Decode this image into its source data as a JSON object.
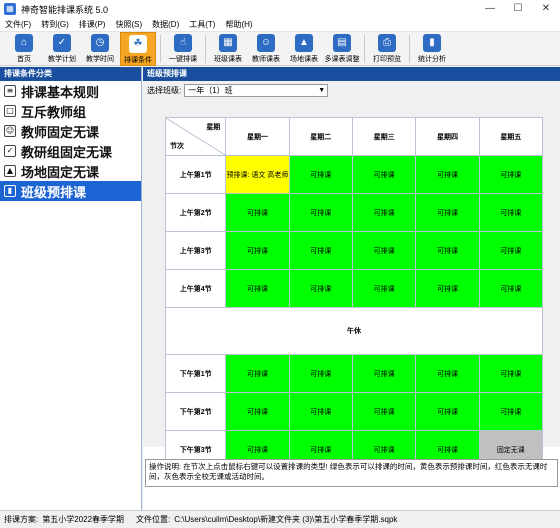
{
  "window": {
    "title": "神奇智能排课系统 5.0",
    "app_icon": "calendar-icon",
    "buttons": [
      "—",
      "☐",
      "✕"
    ]
  },
  "menu": [
    "文件(F)",
    "转到(G)",
    "排课(P)",
    "快照(S)",
    "数据(D)",
    "工具(T)",
    "帮助(H)"
  ],
  "toolbar": {
    "groups": [
      [
        {
          "label": "首页",
          "icon": "home-icon",
          "glyph": "⌂"
        },
        {
          "label": "教学计划",
          "icon": "checklist-icon",
          "glyph": "✓"
        },
        {
          "label": "教学时间",
          "icon": "clock-icon",
          "glyph": "◷"
        },
        {
          "label": "排课条件",
          "icon": "conditions-icon",
          "glyph": "☘",
          "active": true
        }
      ],
      [
        {
          "label": "一键排课",
          "icon": "tap-icon",
          "glyph": "☝"
        }
      ],
      [
        {
          "label": "班级课表",
          "icon": "class-table-icon",
          "glyph": "▦"
        },
        {
          "label": "教师课表",
          "icon": "teacher-table-icon",
          "glyph": "☺"
        },
        {
          "label": "场地课表",
          "icon": "venue-table-icon",
          "glyph": "▲"
        },
        {
          "label": "多课表调整",
          "icon": "multi-table-icon",
          "glyph": "▤"
        }
      ],
      [
        {
          "label": "打印预览",
          "icon": "print-icon",
          "glyph": "⎙"
        }
      ],
      [
        {
          "label": "统计分析",
          "icon": "chart-icon",
          "glyph": "▮"
        }
      ]
    ]
  },
  "left_panel": {
    "header": "排课条件分类",
    "items": [
      {
        "label": "排课基本规则",
        "icon": "rules-icon",
        "glyph": "≡"
      },
      {
        "label": "互斥教师组",
        "icon": "group-icon",
        "glyph": "□"
      },
      {
        "label": "教师固定无课",
        "icon": "teacher-icon",
        "glyph": "☺"
      },
      {
        "label": "教研组固定无课",
        "icon": "research-group-icon",
        "glyph": "✓"
      },
      {
        "label": "场地固定无课",
        "icon": "venue-icon",
        "glyph": "▲"
      },
      {
        "label": "班级预排课",
        "icon": "book-icon",
        "glyph": "▮",
        "selected": true
      }
    ]
  },
  "right_panel": {
    "header": "班级预排课",
    "select_label": "选择班级:",
    "select_value": "一年（1）班",
    "corner_day": "星期",
    "corner_period": "节次",
    "days": [
      "星期一",
      "星期二",
      "星期三",
      "星期四",
      "星期五"
    ],
    "noon_label": "午休",
    "rows": [
      {
        "period": "上午第1节",
        "cells": [
          {
            "text": "预排课: 语文 高老师",
            "state": "pre"
          },
          {
            "text": "可排课",
            "state": "ok"
          },
          {
            "text": "可排课",
            "state": "ok"
          },
          {
            "text": "可排课",
            "state": "ok"
          },
          {
            "text": "可排课",
            "state": "ok"
          }
        ]
      },
      {
        "period": "上午第2节",
        "cells": [
          {
            "text": "可排课",
            "state": "ok"
          },
          {
            "text": "可排课",
            "state": "ok"
          },
          {
            "text": "可排课",
            "state": "ok"
          },
          {
            "text": "可排课",
            "state": "ok"
          },
          {
            "text": "可排课",
            "state": "ok"
          }
        ]
      },
      {
        "period": "上午第3节",
        "cells": [
          {
            "text": "可排课",
            "state": "ok"
          },
          {
            "text": "可排课",
            "state": "ok"
          },
          {
            "text": "可排课",
            "state": "ok"
          },
          {
            "text": "可排课",
            "state": "ok"
          },
          {
            "text": "可排课",
            "state": "ok"
          }
        ]
      },
      {
        "period": "上午第4节",
        "cells": [
          {
            "text": "可排课",
            "state": "ok"
          },
          {
            "text": "可排课",
            "state": "ok"
          },
          {
            "text": "可排课",
            "state": "ok"
          },
          {
            "text": "可排课",
            "state": "ok"
          },
          {
            "text": "可排课",
            "state": "ok"
          }
        ]
      },
      {
        "period": "下午第1节",
        "cells": [
          {
            "text": "可排课",
            "state": "ok"
          },
          {
            "text": "可排课",
            "state": "ok"
          },
          {
            "text": "可排课",
            "state": "ok"
          },
          {
            "text": "可排课",
            "state": "ok"
          },
          {
            "text": "可排课",
            "state": "ok"
          }
        ]
      },
      {
        "period": "下午第2节",
        "cells": [
          {
            "text": "可排课",
            "state": "ok"
          },
          {
            "text": "可排课",
            "state": "ok"
          },
          {
            "text": "可排课",
            "state": "ok"
          },
          {
            "text": "可排课",
            "state": "ok"
          },
          {
            "text": "可排课",
            "state": "ok"
          }
        ]
      },
      {
        "period": "下午第3节",
        "cells": [
          {
            "text": "可排课",
            "state": "ok"
          },
          {
            "text": "可排课",
            "state": "ok"
          },
          {
            "text": "可排课",
            "state": "ok"
          },
          {
            "text": "可排课",
            "state": "ok"
          },
          {
            "text": "固定无课",
            "state": "fixed"
          }
        ]
      }
    ],
    "info": "操作说明: 在节次上点击鼠标右键可以设置排课的类型! 绿色表示可以排课的时间，黄色表示预排课时间，红色表示无课时间，灰色表示全校无课或活动时间。"
  },
  "status": {
    "plan_label": "排课方案:",
    "plan_value": "第五小学2022春季学期",
    "file_label": "文件位置:",
    "file_value": "C:\\Users\\cuilm\\Desktop\\新建文件夹 (3)\\第五小学春季学期.sqpk"
  },
  "colors": {
    "ok": "#00ff00",
    "pre": "#ffff00",
    "fixed": "#c0c0c0",
    "header_blue": "#1a4fa0",
    "selected_blue": "#1c63d4",
    "active_tool": "#f6a623"
  }
}
